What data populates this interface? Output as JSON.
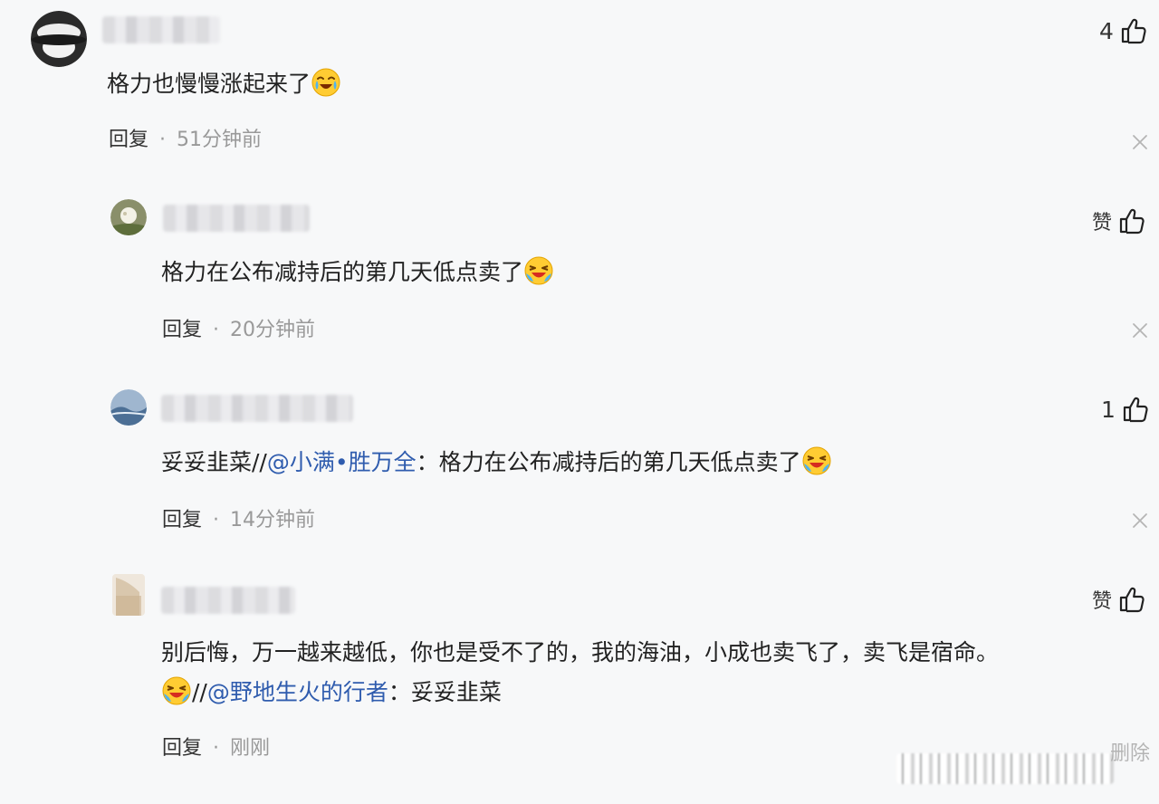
{
  "comments": [
    {
      "text_segments": [
        "格力也慢慢涨起来了"
      ],
      "reply": "回复",
      "time": "51分钟前",
      "likes": "4"
    },
    {
      "text_segments": [
        "格力在公布减持后的第几天低点卖了"
      ],
      "reply": "回复",
      "time": "20分钟前",
      "likes": "赞"
    },
    {
      "text_segments": [
        "妥妥韭菜//",
        "@小满•胜万全",
        "：格力在公布减持后的第几天低点卖了"
      ],
      "reply": "回复",
      "time": "14分钟前",
      "likes": "1"
    },
    {
      "line1": "别后悔，万一越来越低，你也是受不了的，我的海油，小成也卖飞了，卖飞是宿命。",
      "line2_segments": [
        "//",
        "@野地生火的行者",
        "：妥妥韭菜"
      ],
      "reply": "回复",
      "time": "刚刚",
      "likes": "赞"
    }
  ],
  "separator": "·",
  "watermark_text": "删除",
  "icons": {
    "like": "thumbs-up-icon",
    "close": "close-icon",
    "emoji": "crying-laughing-emoji-icon"
  },
  "colors": {
    "mention": "#2f5cae",
    "time": "#999999",
    "background": "#f7f8f9"
  }
}
